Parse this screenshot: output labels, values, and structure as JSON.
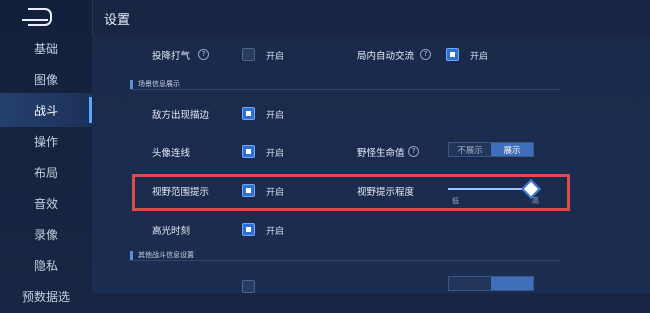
{
  "header": {
    "title": "设置"
  },
  "sidebar": {
    "items": [
      {
        "label": "基础"
      },
      {
        "label": "图像"
      },
      {
        "label": "战斗"
      },
      {
        "label": "操作"
      },
      {
        "label": "布局"
      },
      {
        "label": "音效"
      },
      {
        "label": "录像"
      },
      {
        "label": "隐私"
      },
      {
        "label": "预数据选"
      }
    ],
    "active_index": 2
  },
  "settings": {
    "row1": {
      "surrender": {
        "label": "投降打气",
        "state_label": "开启",
        "checked": false,
        "help": "?"
      },
      "auto_chat": {
        "label": "局内自动交流",
        "state_label": "开启",
        "checked": true,
        "help": "?"
      }
    },
    "section1": {
      "title": "场景信息展示"
    },
    "enemy_outline": {
      "label": "敌方出现描边",
      "state_label": "开启",
      "checked": true
    },
    "avatar_line": {
      "label": "头像连线",
      "state_label": "开启",
      "checked": true
    },
    "monster_hp": {
      "label": "野怪生命值",
      "help": "?",
      "options": [
        "不展示",
        "展示"
      ],
      "selected": "展示"
    },
    "vision_hint": {
      "label": "视野范围提示",
      "state_label": "开启",
      "checked": true
    },
    "vision_level": {
      "label": "视野提示程度",
      "min_label": "低",
      "max_label": "高",
      "value": 0.9
    },
    "highlight_moment": {
      "label": "高光时刻",
      "state_label": "开启",
      "checked": true
    },
    "section2": {
      "title": "其他战斗信息设置"
    }
  },
  "colors": {
    "highlight_box": "#e14a4a",
    "accent": "#2f6fd2"
  }
}
